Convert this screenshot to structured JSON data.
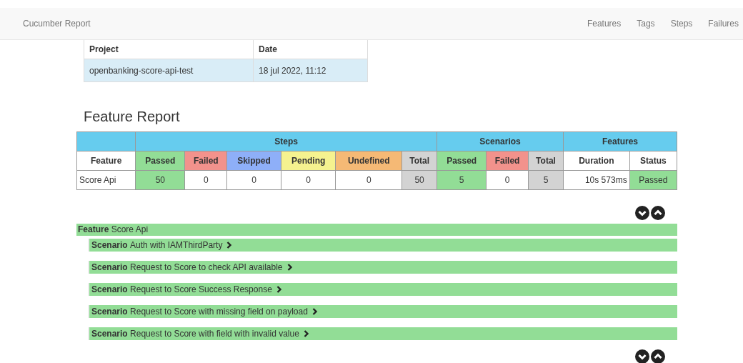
{
  "navbar": {
    "brand": "Cucumber Report",
    "links": [
      "Features",
      "Tags",
      "Steps",
      "Failures"
    ]
  },
  "project_table": {
    "columns": [
      "Project",
      "Date"
    ],
    "row": [
      "openbanking-score-api-test",
      "18 jul 2022, 11:12"
    ]
  },
  "heading": "Feature Report",
  "stats_table": {
    "groups": [
      "Steps",
      "Scenarios",
      "Features"
    ],
    "columns": [
      {
        "label": "Feature",
        "kind": "plain"
      },
      {
        "label": "Passed",
        "kind": "passed"
      },
      {
        "label": "Failed",
        "kind": "failed"
      },
      {
        "label": "Skipped",
        "kind": "skipped"
      },
      {
        "label": "Pending",
        "kind": "pending"
      },
      {
        "label": "Undefined",
        "kind": "undefined"
      },
      {
        "label": "Total",
        "kind": "total"
      },
      {
        "label": "Passed",
        "kind": "passed"
      },
      {
        "label": "Failed",
        "kind": "failed"
      },
      {
        "label": "Total",
        "kind": "total"
      },
      {
        "label": "Duration",
        "kind": "plain"
      },
      {
        "label": "Status",
        "kind": "plain"
      }
    ],
    "rows": [
      {
        "cells": [
          {
            "text": "Score Api",
            "kind": "name"
          },
          {
            "text": "50",
            "kind": "passed"
          },
          {
            "text": "0",
            "kind": "plain"
          },
          {
            "text": "0",
            "kind": "plain"
          },
          {
            "text": "0",
            "kind": "plain"
          },
          {
            "text": "0",
            "kind": "plain"
          },
          {
            "text": "50",
            "kind": "total"
          },
          {
            "text": "5",
            "kind": "passed"
          },
          {
            "text": "0",
            "kind": "plain"
          },
          {
            "text": "5",
            "kind": "total"
          },
          {
            "text": "10s 573ms",
            "kind": "duration"
          },
          {
            "text": "Passed",
            "kind": "passed"
          }
        ]
      }
    ]
  },
  "feature": {
    "keyword": "Feature",
    "name": "Score Api",
    "passed": true,
    "scenarios": [
      {
        "keyword": "Scenario",
        "name": "Auth with IAMThirdParty",
        "passed": true
      },
      {
        "keyword": "Scenario",
        "name": "Request to Score to check API available",
        "passed": true
      },
      {
        "keyword": "Scenario",
        "name": "Request to Score Success Response",
        "passed": true
      },
      {
        "keyword": "Scenario",
        "name": "Request to Score with missing field on payload",
        "passed": true
      },
      {
        "keyword": "Scenario",
        "name": "Request to Score with field with invalid value",
        "passed": true
      }
    ]
  }
}
